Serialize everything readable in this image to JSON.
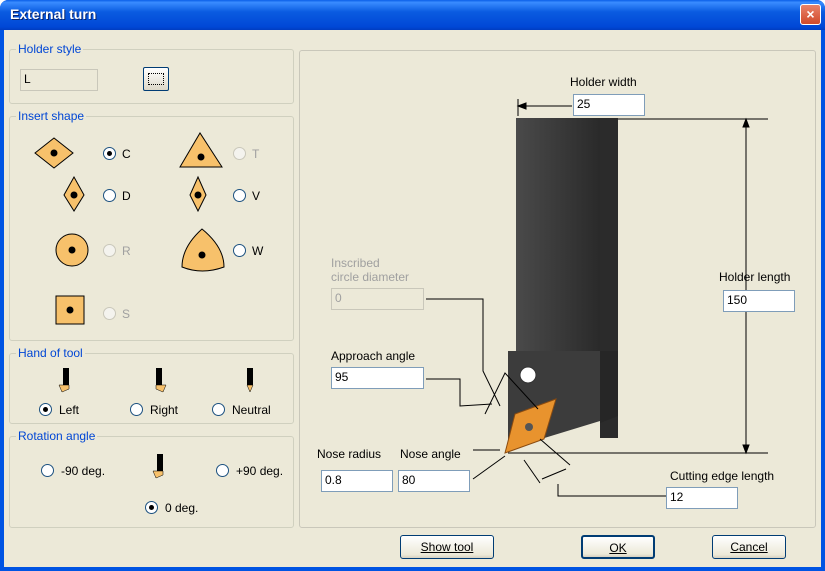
{
  "window": {
    "title": "External turn",
    "close_glyph": "×"
  },
  "holder_style": {
    "title": "Holder style",
    "value": "L"
  },
  "insert_shape": {
    "title": "Insert shape",
    "options": [
      {
        "label": "C",
        "selected": true,
        "enabled": true
      },
      {
        "label": "T",
        "selected": false,
        "enabled": false
      },
      {
        "label": "D",
        "selected": false,
        "enabled": true
      },
      {
        "label": "V",
        "selected": false,
        "enabled": true
      },
      {
        "label": "R",
        "selected": false,
        "enabled": false
      },
      {
        "label": "W",
        "selected": false,
        "enabled": true
      },
      {
        "label": "S",
        "selected": false,
        "enabled": false
      }
    ],
    "shape_color": "#f7c16b"
  },
  "hand_of_tool": {
    "title": "Hand of tool",
    "left": "Left",
    "right": "Right",
    "neutral": "Neutral",
    "selected": "Left"
  },
  "rotation_angle": {
    "title": "Rotation angle",
    "minus90": "-90 deg.",
    "plus90": "+90 deg.",
    "zero": "0 deg.",
    "selected": "0 deg."
  },
  "diagram": {
    "holder_width_label": "Holder width",
    "holder_width": "25",
    "holder_length_label": "Holder length",
    "holder_length": "150",
    "inscribed_label_1": "Inscribed",
    "inscribed_label_2": "circle diameter",
    "inscribed_value": "0",
    "approach_angle_label": "Approach angle",
    "approach_angle": "95",
    "nose_radius_label": "Nose radius",
    "nose_radius": "0.8",
    "nose_angle_label": "Nose angle",
    "nose_angle": "80",
    "cutting_edge_label": "Cutting edge length",
    "cutting_edge": "12"
  },
  "buttons": {
    "show_tool": "Show tool",
    "ok": "OK",
    "cancel": "Cancel"
  }
}
